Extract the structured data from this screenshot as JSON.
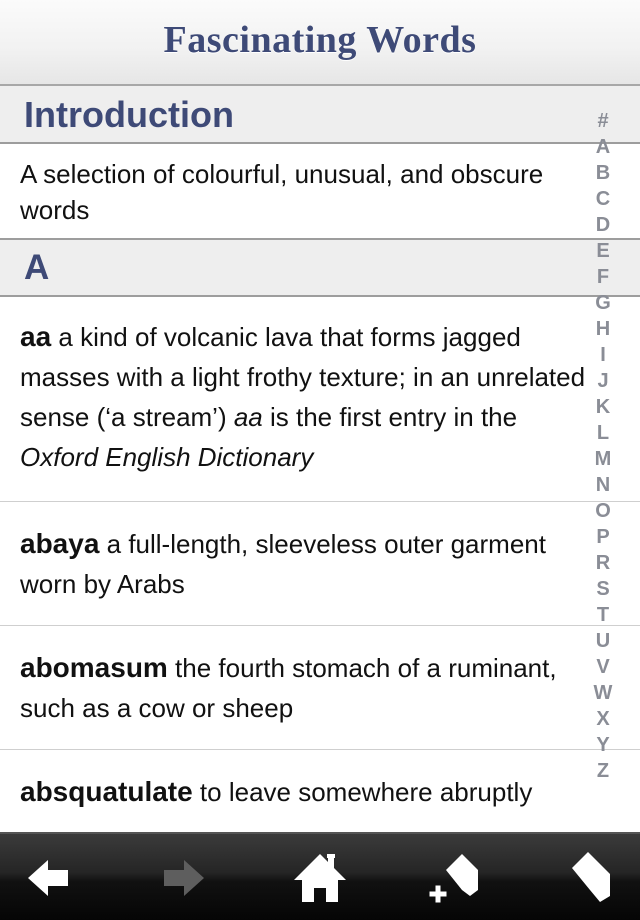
{
  "app": {
    "title": "Fascinating Words"
  },
  "sections": {
    "introduction": {
      "header": "Introduction",
      "text": "A selection of colourful, unusual, and obscure words"
    },
    "a": {
      "header": "A"
    }
  },
  "entries": [
    {
      "word": "aa",
      "def_part1": " a kind of volcanic lava that forms jagged masses with a light frothy texture; in an unrelated sense (‘a stream’) ",
      "def_italic1": "aa",
      "def_part2": " is the first entry in the ",
      "def_italic2": "Oxford English Dictionary"
    },
    {
      "word": "abaya",
      "definition": " a full-length, sleeveless outer garment worn by Arabs"
    },
    {
      "word": "abomasum",
      "definition": " the fourth stomach of a ruminant, such as a cow or sheep"
    },
    {
      "word": "absquatulate",
      "definition": " to leave somewhere abruptly"
    }
  ],
  "index": [
    "#",
    "A",
    "B",
    "C",
    "D",
    "E",
    "F",
    "G",
    "H",
    "I",
    "J",
    "K",
    "L",
    "M",
    "N",
    "O",
    "P",
    "R",
    "S",
    "T",
    "U",
    "V",
    "W",
    "X",
    "Y",
    "Z"
  ],
  "toolbar": {
    "back_icon": "arrow-left-icon",
    "forward_icon": "arrow-right-icon",
    "home_icon": "home-icon",
    "add_bookmark_icon": "bookmark-add-icon",
    "bookmarks_icon": "bookmark-icon",
    "forward_disabled": true
  },
  "colors": {
    "title": "#3e4a77",
    "section_bg": "#eeeeee",
    "index_letters": "#8a8d96",
    "toolbar_dark": "#111111"
  }
}
